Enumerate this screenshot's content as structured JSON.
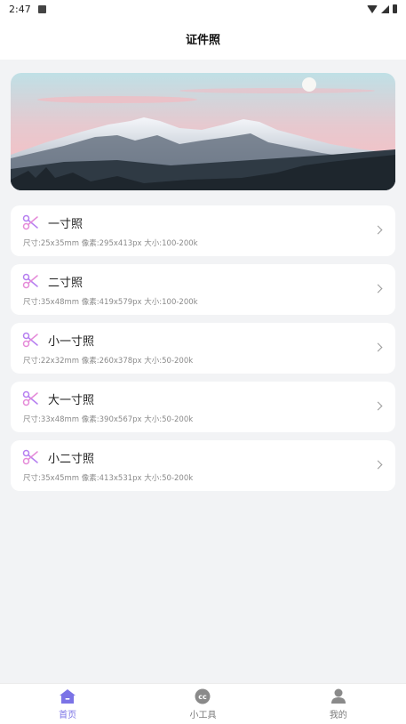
{
  "status_bar": {
    "time": "2:47"
  },
  "header": {
    "title": "证件照"
  },
  "colors": {
    "accent": "#7b73e6",
    "scissors_start": "#b57ef0",
    "scissors_end": "#e58ad8"
  },
  "items": [
    {
      "name": "一寸照",
      "spec": "尺寸:25x35mm 像素:295x413px 大小:100-200k"
    },
    {
      "name": "二寸照",
      "spec": "尺寸:35x48mm 像素:419x579px 大小:100-200k"
    },
    {
      "name": "小一寸照",
      "spec": "尺寸:22x32mm 像素:260x378px 大小:50-200k"
    },
    {
      "name": "大一寸照",
      "spec": "尺寸:33x48mm 像素:390x567px 大小:50-200k"
    },
    {
      "name": "小二寸照",
      "spec": "尺寸:35x45mm 像素:413x531px 大小:50-200k"
    }
  ],
  "bottom_nav": [
    {
      "label": "首页",
      "icon": "home-icon",
      "active": true
    },
    {
      "label": "小工具",
      "icon": "cc-icon",
      "active": false
    },
    {
      "label": "我的",
      "icon": "user-icon",
      "active": false
    }
  ]
}
